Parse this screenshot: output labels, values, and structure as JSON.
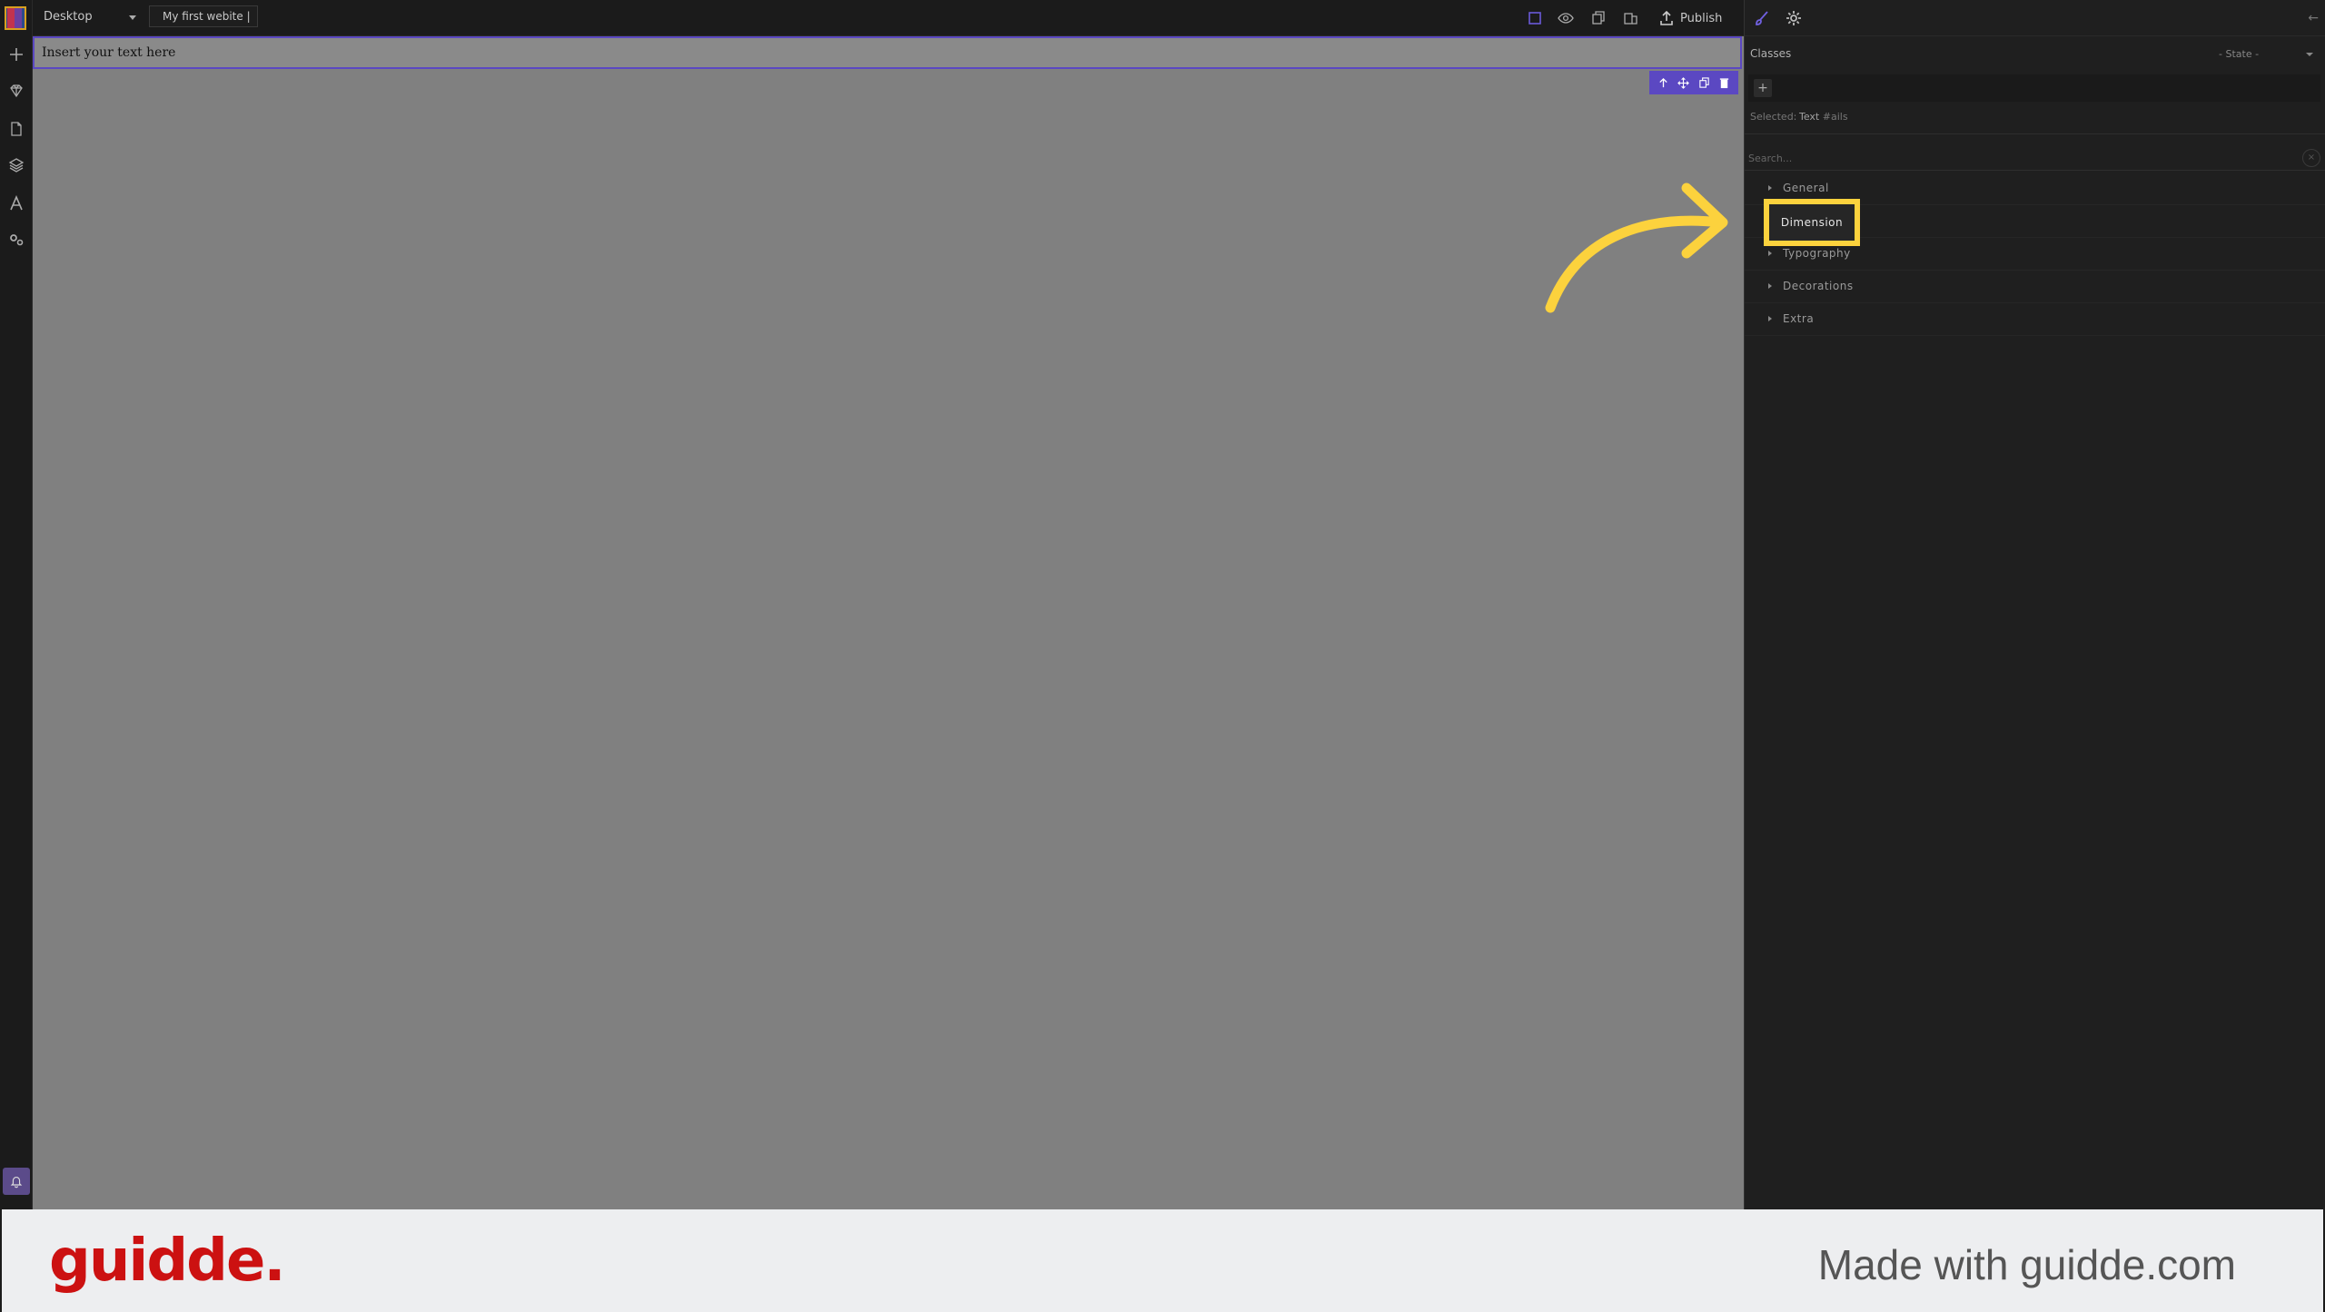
{
  "topbar": {
    "device": "Desktop",
    "site_name": "My first webite |",
    "publish_label": "Publish"
  },
  "canvas": {
    "text_block": "Insert your text here"
  },
  "right_panel": {
    "classes_label": "Classes",
    "state_select": "- State -",
    "add_class": "+",
    "selected_label": "Selected:",
    "selected_value": "Text",
    "selected_id": "#ails",
    "search_placeholder": "Search...",
    "search_clear": "×",
    "collapse": "←",
    "sectors": [
      {
        "label": "General"
      },
      {
        "label": "Dimension"
      },
      {
        "label": "Typography"
      },
      {
        "label": "Decorations"
      },
      {
        "label": "Extra"
      }
    ]
  },
  "annotation": {
    "highlight_color": "#fcd23d"
  },
  "colors": {
    "accent": "#5b48c2",
    "brand_red": "#cc1111"
  },
  "footer": {
    "brand": "guidde.",
    "made_with": "Made with guidde.com"
  }
}
